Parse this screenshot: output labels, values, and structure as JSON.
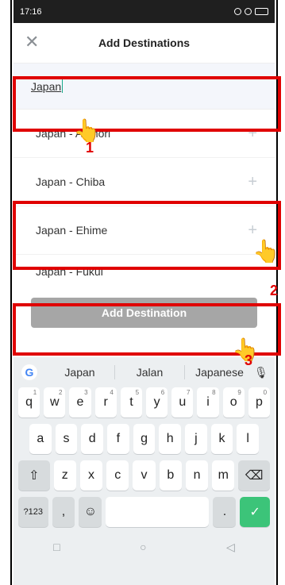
{
  "status_bar": {
    "time": "17:16"
  },
  "header": {
    "title": "Add Destinations"
  },
  "search": {
    "value": "Japan"
  },
  "results": [
    {
      "label": "Japan - Aomori"
    },
    {
      "label": "Japan - Chiba"
    },
    {
      "label": "Japan - Ehime"
    },
    {
      "label": "Japan - Fukui"
    }
  ],
  "add_button": {
    "label": "Add Destination"
  },
  "keyboard": {
    "suggestions": [
      "Japan",
      "Jalan",
      "Japanese"
    ],
    "row1": [
      "q",
      "w",
      "e",
      "r",
      "t",
      "y",
      "u",
      "i",
      "o",
      "p"
    ],
    "row1_hints": [
      "1",
      "2",
      "3",
      "4",
      "5",
      "6",
      "7",
      "8",
      "9",
      "0"
    ],
    "row2": [
      "a",
      "s",
      "d",
      "f",
      "g",
      "h",
      "j",
      "k",
      "l"
    ],
    "row3": [
      "z",
      "x",
      "c",
      "v",
      "b",
      "n",
      "m"
    ],
    "sym_label": "?123",
    "comma": ",",
    "period": "."
  },
  "annotations": [
    "1",
    "2",
    "3"
  ]
}
